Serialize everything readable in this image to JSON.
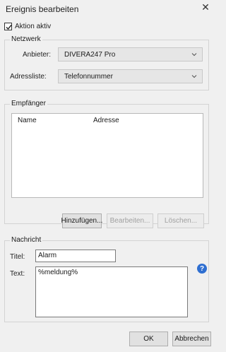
{
  "window": {
    "title": "Ereignis bearbeiten",
    "close_symbol": "✕"
  },
  "aktion_aktiv": {
    "label": "Aktion aktiv",
    "checked": true
  },
  "netzwerk": {
    "group_label": "Netzwerk",
    "anbieter": {
      "label": "Anbieter:",
      "value": "DIVERA247 Pro"
    },
    "adressliste": {
      "label": "Adressliste:",
      "value": "Telefonnummer"
    }
  },
  "empfaenger": {
    "group_label": "Empfänger",
    "columns": [
      "Name",
      "Adresse"
    ],
    "buttons": {
      "add": "Hinzufügen...",
      "edit": "Bearbeiten...",
      "delete": "Löschen..."
    }
  },
  "nachricht": {
    "group_label": "Nachricht",
    "titel": {
      "label": "Titel:",
      "value": "Alarm"
    },
    "text": {
      "label": "Text:",
      "value": "%meldung%"
    }
  },
  "footer": {
    "ok": "OK",
    "cancel": "Abbrechen"
  },
  "colors": {
    "accent_help": "#2f6fd1",
    "window_bg": "#f0f0f0"
  },
  "icons": {
    "help": "help-icon",
    "close": "close-icon",
    "dropdown": "chevron-down-icon",
    "check": "check-icon"
  }
}
